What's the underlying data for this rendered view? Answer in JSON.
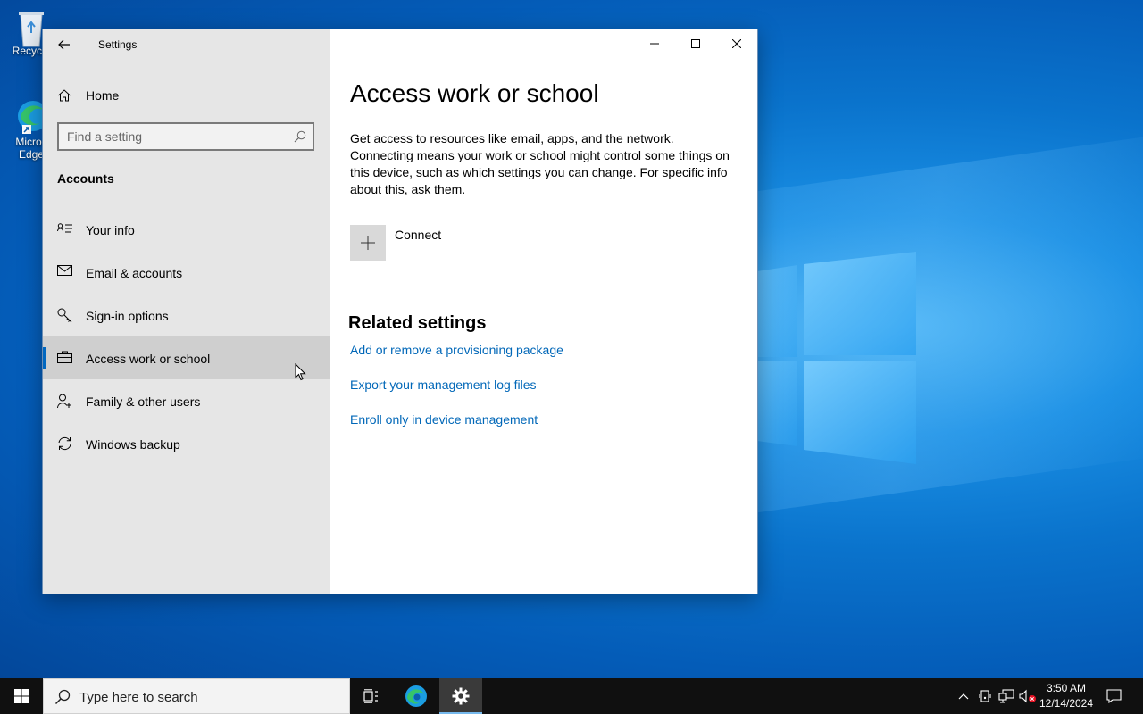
{
  "desktop": {
    "icons": [
      {
        "label": "Recycle"
      },
      {
        "label_line1": "Micros",
        "label_line2": "Edge"
      }
    ]
  },
  "window": {
    "app_title": "Settings",
    "sidebar": {
      "home_label": "Home",
      "search_placeholder": "Find a setting",
      "section_title": "Accounts",
      "items": [
        {
          "label": "Your info",
          "icon": "contact-info-icon"
        },
        {
          "label": "Email & accounts",
          "icon": "mail-icon"
        },
        {
          "label": "Sign-in options",
          "icon": "key-icon"
        },
        {
          "label": "Access work or school",
          "icon": "briefcase-icon",
          "selected": true
        },
        {
          "label": "Family & other users",
          "icon": "add-person-icon"
        },
        {
          "label": "Windows backup",
          "icon": "sync-icon"
        }
      ]
    },
    "content": {
      "title": "Access work or school",
      "description": "Get access to resources like email, apps, and the network. Connecting means your work or school might control some things on this device, such as which settings you can change. For specific info about this, ask them.",
      "connect_label": "Connect",
      "related_title": "Related settings",
      "links": [
        "Add or remove a provisioning package",
        "Export your management log files",
        "Enroll only in device management"
      ]
    }
  },
  "taskbar": {
    "search_placeholder": "Type here to search",
    "time": "3:50 AM",
    "date": "12/14/2024"
  },
  "colors": {
    "accent": "#0067c0",
    "link": "#0067b8",
    "sidebar_bg": "#e6e6e6",
    "taskbar_bg": "#101010"
  }
}
